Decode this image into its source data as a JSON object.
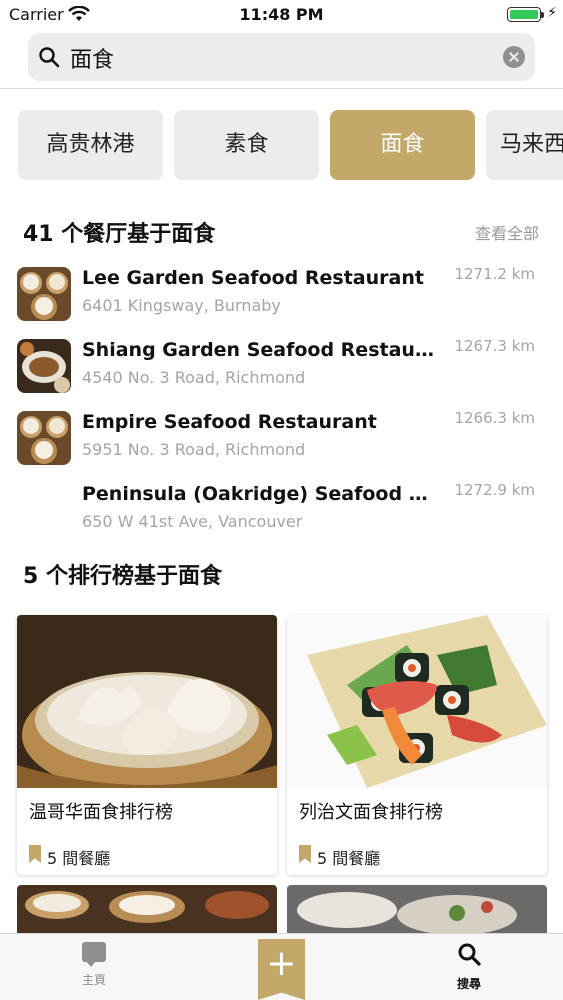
{
  "status_bar": {
    "carrier": "Carrier",
    "time": "11:48 PM"
  },
  "search": {
    "value": "面食"
  },
  "categories": [
    {
      "label": "高贵林港",
      "active": false
    },
    {
      "label": "素食",
      "active": false
    },
    {
      "label": "面食",
      "active": true
    },
    {
      "label": "马来西",
      "active": false
    }
  ],
  "restaurants_section": {
    "title": "41 个餐厅基于面食",
    "see_all": "查看全部"
  },
  "restaurants": [
    {
      "name": "Lee Garden Seafood Restaurant",
      "address": "6401 Kingsway, Burnaby",
      "distance": "1271.2 km",
      "thumb": "dim-sum"
    },
    {
      "name": "Shiang Garden Seafood Restaurant",
      "address": "4540 No. 3 Road, Richmond",
      "distance": "1267.3 km",
      "thumb": "dishes"
    },
    {
      "name": "Empire Seafood Restaurant",
      "address": "5951 No. 3 Road, Richmond",
      "distance": "1266.3 km",
      "thumb": "dim-sum"
    },
    {
      "name": "Peninsula (Oakridge) Seafood Rest...",
      "address": "650 W 41st Ave, Vancouver",
      "distance": "1272.9 km",
      "thumb": "none"
    }
  ],
  "rankings_section": {
    "title": "5 个排行榜基于面食"
  },
  "rankings": [
    {
      "title": "温哥华面食排行榜",
      "count": "5 間餐廳",
      "image": "dumplings"
    },
    {
      "title": "列治文面食排行榜",
      "count": "5 間餐廳",
      "image": "sushi"
    }
  ],
  "tab_bar": {
    "home_label": "主頁",
    "add_label": "+",
    "search_label": "搜尋"
  },
  "colors": {
    "accent": "#c4a86a",
    "chip_bg": "#ececec",
    "muted": "#a5a5a5"
  }
}
